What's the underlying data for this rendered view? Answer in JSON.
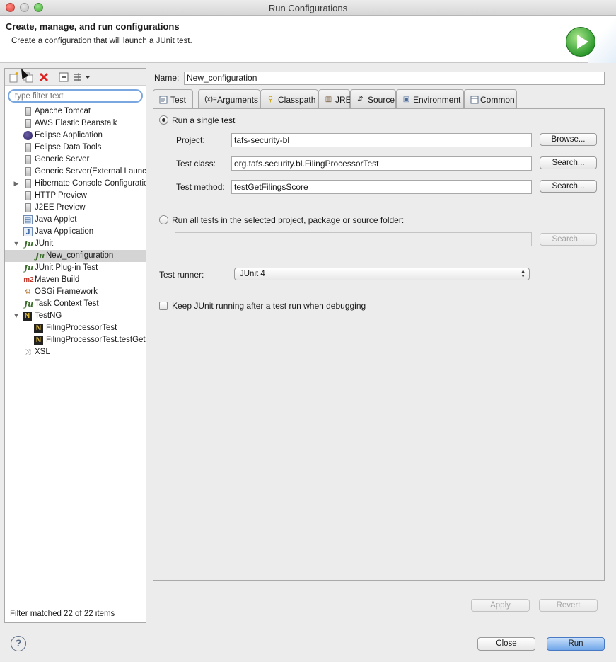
{
  "window": {
    "title": "Run Configurations"
  },
  "header": {
    "title": "Create, manage, and run configurations",
    "subtitle": "Create a configuration that will launch a JUnit test."
  },
  "sidebar": {
    "filter_placeholder": "type filter text",
    "status": "Filter matched 22 of 22 items",
    "items": [
      {
        "label": "Apache Tomcat",
        "icon": "server-icon",
        "depth": 1
      },
      {
        "label": "AWS Elastic Beanstalk",
        "icon": "server-icon",
        "depth": 1
      },
      {
        "label": "Eclipse Application",
        "icon": "eclipse-icon",
        "depth": 1
      },
      {
        "label": "Eclipse Data Tools",
        "icon": "server-icon",
        "depth": 1
      },
      {
        "label": "Generic Server",
        "icon": "server-icon",
        "depth": 1
      },
      {
        "label": "Generic Server(External Launch)",
        "icon": "server-icon",
        "depth": 1
      },
      {
        "label": "Hibernate Console Configuration",
        "icon": "server-icon",
        "depth": 1
      },
      {
        "label": "HTTP Preview",
        "icon": "server-icon",
        "depth": 1
      },
      {
        "label": "J2EE Preview",
        "icon": "server-icon",
        "depth": 1
      },
      {
        "label": "Java Applet",
        "icon": "applet-icon",
        "depth": 1
      },
      {
        "label": "Java Application",
        "icon": "java-app-icon",
        "depth": 1
      },
      {
        "label": "JUnit",
        "icon": "junit-icon",
        "depth": 0
      },
      {
        "label": "New_configuration",
        "icon": "junit-icon",
        "depth": 2
      },
      {
        "label": "JUnit Plug-in Test",
        "icon": "junit-plugin-icon",
        "depth": 1
      },
      {
        "label": "Maven Build",
        "icon": "maven-icon",
        "depth": 1
      },
      {
        "label": "OSGi Framework",
        "icon": "osgi-icon",
        "depth": 1
      },
      {
        "label": "Task Context Test",
        "icon": "junit-icon",
        "depth": 1
      },
      {
        "label": "TestNG",
        "icon": "testng-icon",
        "depth": 0
      },
      {
        "label": "FilingProcessorTest",
        "icon": "testng-icon",
        "depth": 2
      },
      {
        "label": "FilingProcessorTest.testGetFilingsScore",
        "icon": "testng-icon",
        "depth": 2
      },
      {
        "label": "XSL",
        "icon": "xsl-icon",
        "depth": 1
      }
    ]
  },
  "config": {
    "name_label": "Name:",
    "name_value": "New_configuration",
    "tabs": [
      "Test",
      "Arguments",
      "Classpath",
      "JRE",
      "Source",
      "Environment",
      "Common"
    ],
    "run_single_label": "Run a single test",
    "project_label": "Project:",
    "project_value": "tafs-security-bl",
    "browse_label": "Browse...",
    "test_class_label": "Test class:",
    "test_class_value": "org.tafs.security.bl.FilingProcessorTest",
    "search_label": "Search...",
    "test_method_label": "Test method:",
    "test_method_value": "testGetFilingsScore",
    "run_all_label": "Run all tests in the selected project, package or source folder:",
    "runner_label": "Test runner:",
    "runner_value": "JUnit 4",
    "keep_running_label": "Keep JUnit running after a test run when debugging",
    "apply_label": "Apply",
    "revert_label": "Revert"
  },
  "footer": {
    "help": "?",
    "close_label": "Close",
    "run_label": "Run"
  }
}
